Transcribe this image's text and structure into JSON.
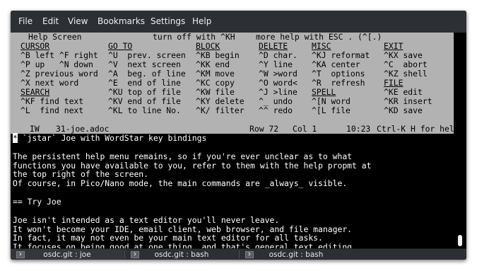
{
  "menubar": {
    "items": [
      "File",
      "Edit",
      "View",
      "Bookmarks",
      "Settings",
      "Help"
    ]
  },
  "help": {
    "title_left": "Help Screen",
    "title_mid": "turn off with ^KH",
    "title_right": "more help with ESC . (^[.)",
    "cursor": {
      "heading": "CURSOR",
      "rows": [
        "^B left ^F right",
        "^P up   ^N down",
        "^Z previous word",
        "^X next word"
      ]
    },
    "search": {
      "heading": "SEARCH",
      "rows": [
        "^KF find text",
        "^L  find next"
      ]
    },
    "goto": {
      "heading": "GO TO",
      "rows": [
        "^U  prev. screen",
        "^V  next screen",
        "^A  beg. of line",
        "^E  end of line",
        "^KU top of file",
        "^KV end of file",
        "^KL to line No."
      ]
    },
    "block": {
      "heading": "BLOCK",
      "rows": [
        "^KB begin",
        "^KK end",
        "^KM move",
        "^KC copy",
        "^KW file",
        "^KY delete",
        "^K/ filter"
      ]
    },
    "delete": {
      "heading": "DELETE",
      "rows": [
        "^D char.",
        "^Y line",
        "^W >word",
        "^O word<",
        "^J >line",
        "^_ undo",
        "^^ redo"
      ]
    },
    "misc": {
      "heading": "MISC",
      "rows": [
        "^KJ reformat",
        "^KA center",
        "^T  options",
        "^R  refresh"
      ]
    },
    "spell": {
      "heading": "SPELL",
      "rows": [
        "^[N word",
        "^[L file"
      ]
    },
    "exit": {
      "heading": "EXIT",
      "rows": [
        "^KX save",
        "^C  abort",
        "^KZ shell"
      ]
    },
    "file": {
      "heading": "FILE",
      "rows": [
        "^KE edit",
        "^KR insert",
        "^KD save"
      ]
    }
  },
  "status": {
    "mode": "IW",
    "filename": "31-joe.adoc",
    "row": "Row 72",
    "col": "Col 1",
    "time": "10:23",
    "hint": "Ctrl-K H for help"
  },
  "editor": {
    "cursor_char": "*",
    "lines": [
      " `jstar` Joe with WordStar key bindings",
      "",
      "The persistent help menu remains, so if you're ever unclear as to what",
      "functions you have available to you, refer to them with the help propmt at",
      "the top right of the screen.",
      "Of course, in Pico/Nano mode, the main commands are _always_ visible.",
      "",
      "== Try Joe",
      "",
      "Joe isn't intended as a text editor you'll never leave.",
      "It won't become your IDE, email client, web browser, and file manager.",
      "In fact, it may not even be your main text editor for all tasks.",
      "It focuses on being good at one thing, and that's general text editing."
    ]
  },
  "tabs": [
    {
      "label": "osdc.git : joe",
      "active": true
    },
    {
      "label": "osdc.git : bash",
      "active": false
    },
    {
      "label": "osdc.git : bash",
      "active": false
    }
  ],
  "icons": {
    "tab_icon": "terminal-prompt-icon"
  },
  "colors": {
    "menubar_bg": "#2c2f33",
    "help_bg": "#b2b2b2",
    "terminal_bg": "#000000",
    "terminal_fg": "#ffffff"
  }
}
